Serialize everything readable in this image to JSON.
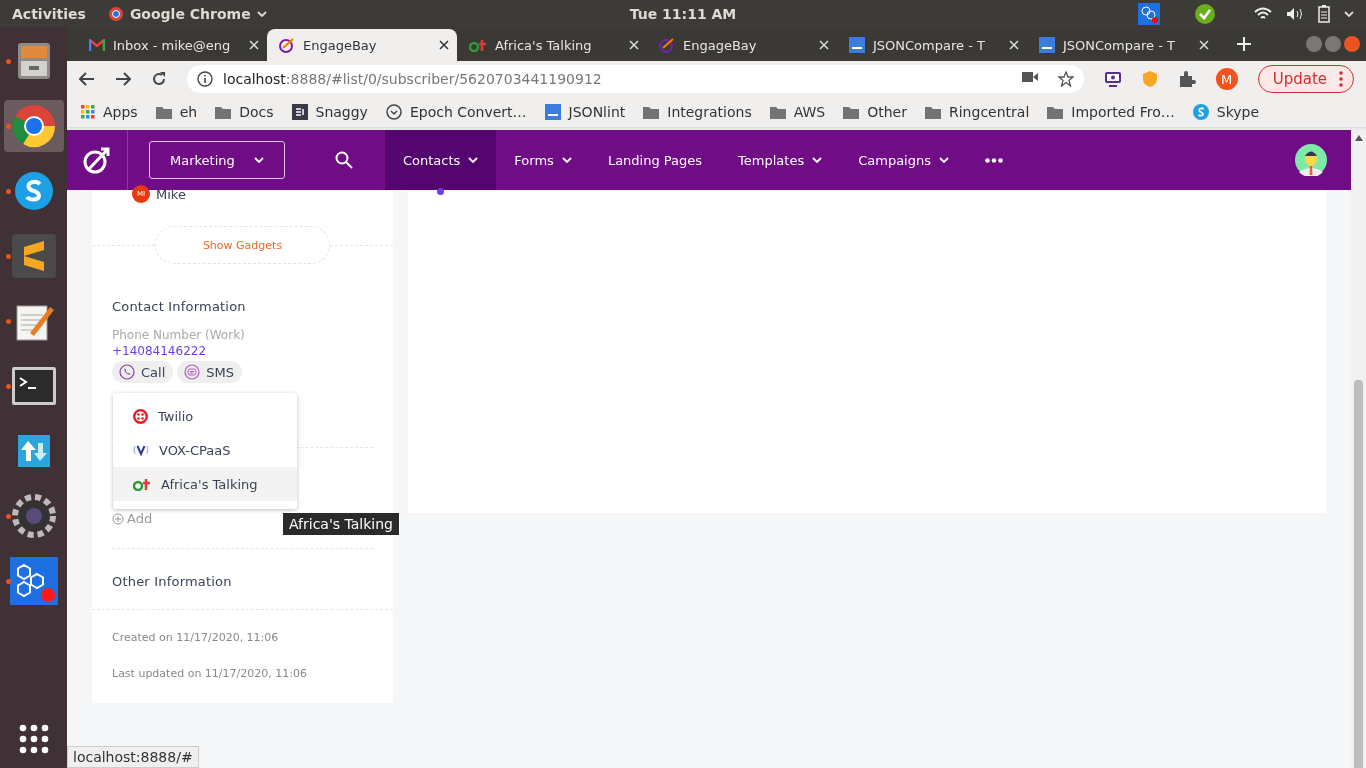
{
  "topbar": {
    "activities": "Activities",
    "app": "Google Chrome",
    "clock": "Tue 11:11 AM"
  },
  "dock": [
    {
      "kind": "cabinet",
      "running": true,
      "selected": false
    },
    {
      "kind": "browser",
      "running": true,
      "selected": true
    },
    {
      "kind": "chat",
      "running": true,
      "selected": false
    },
    {
      "kind": "stripes",
      "running": true,
      "selected": false
    },
    {
      "kind": "notepad",
      "running": true,
      "selected": false
    },
    {
      "kind": "terminal",
      "running": true,
      "selected": false
    },
    {
      "kind": "arrows",
      "running": false,
      "selected": false
    },
    {
      "kind": "gear",
      "running": true,
      "selected": false
    },
    {
      "kind": "hexagons",
      "running": true,
      "selected": false
    }
  ],
  "tabs": [
    {
      "title": "Inbox - mike@eng",
      "kind": "mail",
      "selected": false
    },
    {
      "title": "EngageBay",
      "kind": "logo",
      "selected": true
    },
    {
      "title": "Africa's Talking",
      "kind": "bars",
      "selected": false
    },
    {
      "title": "EngageBay",
      "kind": "logo",
      "selected": false
    },
    {
      "title": "JSONCompare - T",
      "kind": "doc",
      "selected": false
    },
    {
      "title": "JSONCompare - T",
      "kind": "doc",
      "selected": false
    }
  ],
  "address": {
    "host": "localhost",
    "path": ":8888/#list/0/subscriber/5620703441190912"
  },
  "profile_initial": "M",
  "update_button": "Update",
  "bookmarks": [
    {
      "label": "Apps",
      "kind": "grid"
    },
    {
      "label": "eh",
      "kind": "folder"
    },
    {
      "label": "Docs",
      "kind": "folder"
    },
    {
      "label": "Snaggy",
      "kind": "square"
    },
    {
      "label": "Epoch Convert…",
      "kind": "clock"
    },
    {
      "label": "JSONlint",
      "kind": "doc"
    },
    {
      "label": "Integrations",
      "kind": "folder"
    },
    {
      "label": "AWS",
      "kind": "folder"
    },
    {
      "label": "Other",
      "kind": "folder"
    },
    {
      "label": "Ringcentral",
      "kind": "folder"
    },
    {
      "label": "Imported Fro…",
      "kind": "folder"
    },
    {
      "label": "Skype",
      "kind": "chat"
    }
  ],
  "nav": {
    "workspace": "Marketing",
    "items": [
      {
        "label": "Contacts",
        "dropdown": true,
        "selected": true
      },
      {
        "label": "Forms",
        "dropdown": true,
        "selected": false
      },
      {
        "label": "Landing Pages",
        "dropdown": false,
        "selected": false
      },
      {
        "label": "Templates",
        "dropdown": true,
        "selected": false
      },
      {
        "label": "Campaigns",
        "dropdown": true,
        "selected": false
      }
    ]
  },
  "contact": {
    "owner_initials": "MI",
    "owner": "Mike",
    "show_gadgets": "Show Gadgets",
    "section": "Contact Information",
    "phone_label": "Phone Number (Work)",
    "phone": "+14084146222",
    "actions": [
      {
        "label": "Call",
        "kind": "call"
      },
      {
        "label": "SMS",
        "kind": "sms"
      }
    ],
    "providers": [
      {
        "label": "Twilio",
        "kind": "twilio",
        "selected": false
      },
      {
        "label": "VOX-CPaaS",
        "kind": "vox",
        "selected": false
      },
      {
        "label": "Africa's Talking",
        "kind": "at",
        "selected": true
      }
    ],
    "add": "Add",
    "other_section": "Other Information",
    "created": "Created on 11/17/2020, 11:06",
    "updated": "Last updated on 11/17/2020, 11:06"
  },
  "tooltip": "Africa's Talking",
  "status_url": "localhost:8888/#"
}
